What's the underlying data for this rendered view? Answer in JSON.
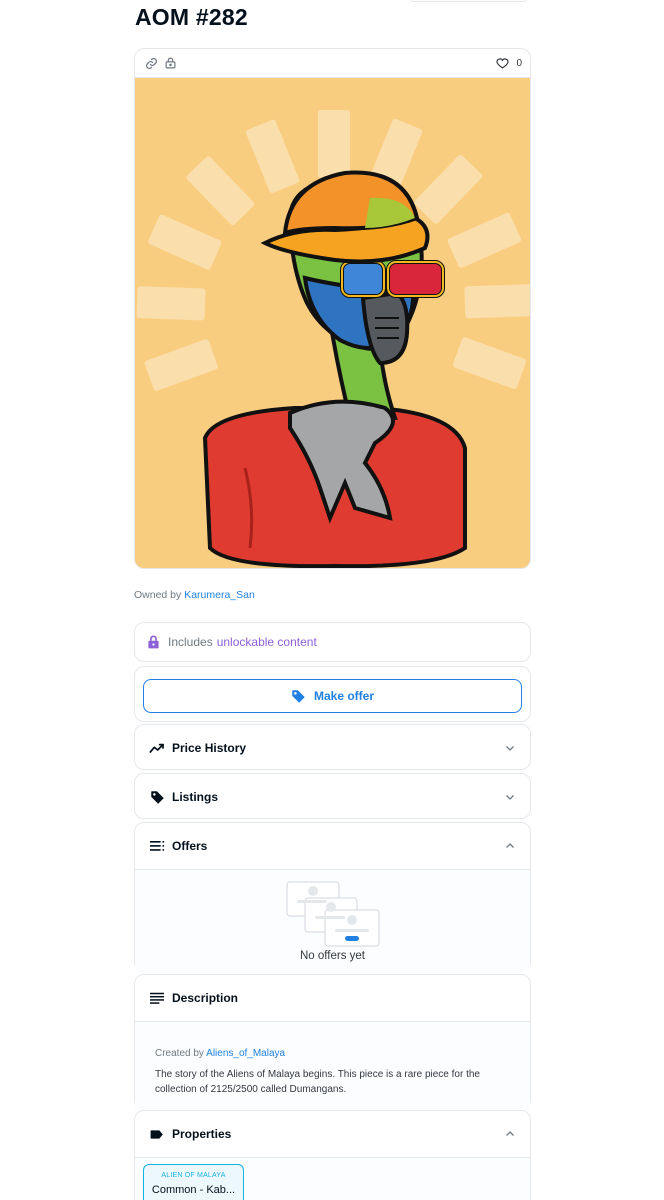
{
  "asset": {
    "title": "AOM #282",
    "favorite_count": "0",
    "owner_prefix": "Owned by",
    "owner_name": "Karumera_San",
    "art_icon": "alien-portrait-image"
  },
  "unlockable": {
    "prefix": "Includes",
    "accent": "unlockable content"
  },
  "offer_button": {
    "label": "Make offer"
  },
  "sections": {
    "price_history": "Price History",
    "listings": "Listings",
    "offers": "Offers",
    "description": "Description",
    "properties": "Properties"
  },
  "offers": {
    "empty_text": "No offers yet"
  },
  "description": {
    "creator_prefix": "Created by",
    "creator_name": "Aliens_of_Malaya",
    "text": "The story of the Aliens of Malaya begins. This piece is a rare piece for the collection of 2125/2500 called Dumangans."
  },
  "properties": {
    "items": [
      {
        "type": "ALIEN OF MALAYA",
        "value": "Common - Kab..."
      }
    ]
  },
  "colors": {
    "accent_blue": "#2081e2",
    "unlock_purple": "#8e60d8",
    "art_background": "#f9cd80",
    "prop_cyan": "#15b2e5"
  }
}
